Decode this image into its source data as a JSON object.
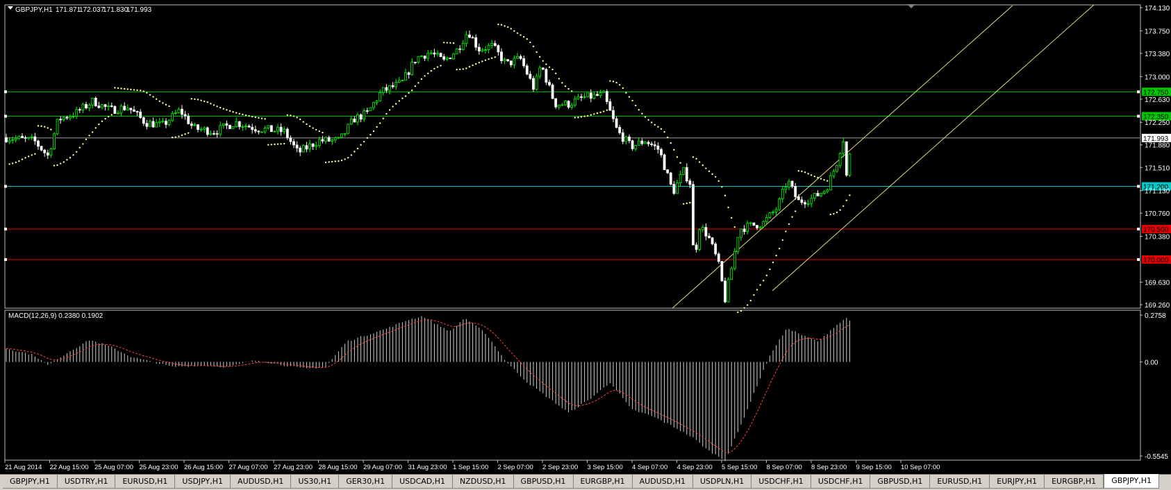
{
  "chart_data": [
    {
      "type": "candlestick",
      "title": "GBPJPY,H1",
      "ohlc_readout": [
        "171.871",
        "172.037",
        "171.830",
        "171.993"
      ],
      "current_price": 171.993,
      "ylim": [
        169.26,
        174.13
      ],
      "y_ticks": [
        174.13,
        173.75,
        173.38,
        173.0,
        172.63,
        172.25,
        171.88,
        171.51,
        171.13,
        170.76,
        170.38,
        169.63,
        169.26
      ],
      "x_ticks": [
        "21 Aug 2014",
        "22 Aug 15:00",
        "25 Aug 07:00",
        "25 Aug 23:00",
        "26 Aug 15:00",
        "27 Aug 07:00",
        "27 Aug 23:00",
        "28 Aug 15:00",
        "29 Aug 07:00",
        "31 Aug 23:00",
        "1 Sep 15:00",
        "2 Sep 07:00",
        "2 Sep 23:00",
        "3 Sep 15:00",
        "4 Sep 07:00",
        "4 Sep 23:00",
        "5 Sep 15:00",
        "8 Sep 07:00",
        "8 Sep 23:00",
        "9 Sep 15:00",
        "10 Sep 07:00"
      ],
      "price_path": [
        [
          0,
          172.0
        ],
        [
          40,
          171.95
        ],
        [
          60,
          171.7
        ],
        [
          75,
          172.3
        ],
        [
          100,
          172.4
        ],
        [
          125,
          172.6
        ],
        [
          150,
          172.45
        ],
        [
          175,
          172.5
        ],
        [
          200,
          172.25
        ],
        [
          225,
          172.2
        ],
        [
          250,
          172.45
        ],
        [
          270,
          172.15
        ],
        [
          300,
          172.1
        ],
        [
          330,
          172.25
        ],
        [
          360,
          172.15
        ],
        [
          400,
          172.1
        ],
        [
          420,
          171.75
        ],
        [
          450,
          171.95
        ],
        [
          480,
          171.95
        ],
        [
          500,
          172.3
        ],
        [
          520,
          172.4
        ],
        [
          540,
          172.75
        ],
        [
          570,
          172.9
        ],
        [
          590,
          173.3
        ],
        [
          610,
          173.4
        ],
        [
          630,
          173.25
        ],
        [
          650,
          173.45
        ],
        [
          665,
          173.75
        ],
        [
          680,
          173.45
        ],
        [
          700,
          173.5
        ],
        [
          720,
          173.2
        ],
        [
          740,
          173.3
        ],
        [
          760,
          172.8
        ],
        [
          770,
          173.2
        ],
        [
          790,
          172.55
        ],
        [
          810,
          172.55
        ],
        [
          830,
          172.65
        ],
        [
          860,
          172.7
        ],
        [
          880,
          172.1
        ],
        [
          900,
          171.85
        ],
        [
          920,
          171.95
        ],
        [
          940,
          171.8
        ],
        [
          960,
          171.1
        ],
        [
          975,
          171.45
        ],
        [
          985,
          171.25
        ],
        [
          990,
          169.95
        ],
        [
          998,
          170.55
        ],
        [
          1010,
          170.4
        ],
        [
          1025,
          169.95
        ],
        [
          1035,
          169.35
        ],
        [
          1045,
          169.9
        ],
        [
          1055,
          170.5
        ],
        [
          1070,
          170.55
        ],
        [
          1090,
          170.6
        ],
        [
          1110,
          170.85
        ],
        [
          1125,
          171.3
        ],
        [
          1140,
          170.95
        ],
        [
          1160,
          171.0
        ],
        [
          1180,
          171.15
        ],
        [
          1195,
          171.55
        ],
        [
          1205,
          172.0
        ],
        [
          1210,
          171.35
        ],
        [
          1218,
          171.99
        ]
      ],
      "horizontal_lines": [
        {
          "price": 172.75,
          "label": "172.750",
          "color": "#00c800"
        },
        {
          "price": 172.35,
          "label": "172.350",
          "color": "#00c800"
        },
        {
          "price": 171.2,
          "label": "171.200",
          "color": "#00c8c8"
        },
        {
          "price": 170.5,
          "label": "170.500",
          "color": "#e00000"
        },
        {
          "price": 170.0,
          "label": "170.000",
          "color": "#e00000"
        }
      ],
      "up_color": "#00ff00",
      "down_color": "#ffffff",
      "sar_color": "#ffff96"
    },
    {
      "type": "histogram",
      "title": "MACD(12,26,9) 0.2380 0.1902",
      "ylim": [
        -0.5545,
        0.2758
      ],
      "y_ticks": [
        0.2758,
        0.0,
        -0.5545
      ],
      "y_tick_labels": [
        "0.2758",
        "0.00",
        "-0.5545"
      ],
      "macd_path": [
        [
          0,
          0.08
        ],
        [
          40,
          0.04
        ],
        [
          60,
          -0.02
        ],
        [
          90,
          0.06
        ],
        [
          120,
          0.13
        ],
        [
          150,
          0.09
        ],
        [
          180,
          0.03
        ],
        [
          210,
          0.0
        ],
        [
          240,
          -0.03
        ],
        [
          280,
          -0.02
        ],
        [
          320,
          -0.03
        ],
        [
          360,
          0.01
        ],
        [
          400,
          -0.02
        ],
        [
          430,
          -0.04
        ],
        [
          460,
          -0.03
        ],
        [
          490,
          0.12
        ],
        [
          520,
          0.16
        ],
        [
          550,
          0.2
        ],
        [
          580,
          0.25
        ],
        [
          600,
          0.27
        ],
        [
          620,
          0.22
        ],
        [
          640,
          0.18
        ],
        [
          660,
          0.26
        ],
        [
          690,
          0.17
        ],
        [
          720,
          0.0
        ],
        [
          750,
          -0.12
        ],
        [
          780,
          -0.21
        ],
        [
          810,
          -0.3
        ],
        [
          840,
          -0.22
        ],
        [
          870,
          -0.12
        ],
        [
          900,
          -0.28
        ],
        [
          930,
          -0.32
        ],
        [
          960,
          -0.38
        ],
        [
          990,
          -0.45
        ],
        [
          1010,
          -0.52
        ],
        [
          1035,
          -0.58
        ],
        [
          1055,
          -0.4
        ],
        [
          1075,
          -0.2
        ],
        [
          1090,
          -0.05
        ],
        [
          1105,
          0.08
        ],
        [
          1125,
          0.2
        ],
        [
          1150,
          0.15
        ],
        [
          1170,
          0.12
        ],
        [
          1190,
          0.2
        ],
        [
          1210,
          0.26
        ],
        [
          1218,
          0.24
        ]
      ],
      "signal_color": "#ff4040"
    }
  ],
  "tabs": [
    "GBPJPY,H1",
    "USDTRY,H1",
    "EURUSD,H1",
    "USDJPY,H1",
    "AUDUSD,H1",
    "US30,H1",
    "GER30,H1",
    "USDCAD,H1",
    "NZDUSD,H1",
    "GBPUSD,H1",
    "EURGBP,H1",
    "AUDUSD,H1",
    "USDPLN,H1",
    "USDCHF,H1",
    "USDCHF,H1",
    "GBPUSD,H1",
    "EURUSD,H1",
    "EURJPY,H1",
    "EURGBP,H1",
    "GBPJPY,H1"
  ],
  "active_tab_index": 19
}
